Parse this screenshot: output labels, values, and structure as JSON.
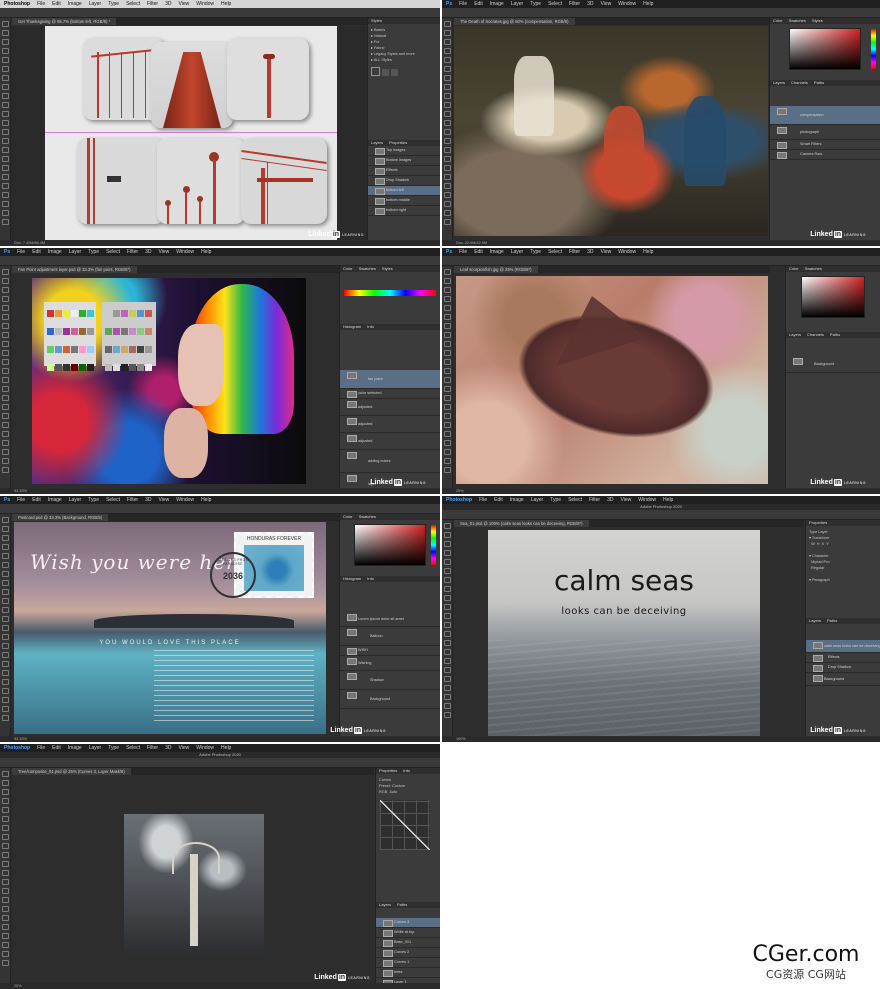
{
  "app": {
    "name": "Photoshop",
    "menu": [
      "Photoshop",
      "File",
      "Edit",
      "Image",
      "Layer",
      "Type",
      "Select",
      "Filter",
      "3D",
      "View",
      "Window",
      "Help"
    ]
  },
  "tiles": [
    {
      "tab": "Get Thanksgiving @ 95.7% (bottom left, RGB/8) *",
      "status": "Doc: 7.42M/86.4M",
      "layers": [
        "Top images",
        "Bottom images",
        "Effects",
        "Drop Shadow",
        "bottom left",
        "bottom middle",
        "bottom right"
      ]
    },
    {
      "tab": "The Death of Socrates.jpg @ 50% (compensation, RGB/8)",
      "status": "Doc: 22.9M/42.9M",
      "layers": [
        "compensation",
        "photograph",
        "Smart Filters",
        "Camera Raw"
      ]
    },
    {
      "tab": "Fan Point adjustment layer.psd @ 33.3% (fan point, RGB/8*)",
      "status": "33.33%",
      "layers": [
        "fan point",
        "color selected",
        "adjusted",
        "adjusted",
        "adjusted",
        "adding colors",
        "layer"
      ]
    },
    {
      "tab": "Leaf scorpionfish.jpg @ 25% (RGB/8*)",
      "status": "25%",
      "layers": [
        "Background"
      ]
    },
    {
      "tab": "Postcard.psd @ 33.3% (Background, RGB/8)",
      "status": "33.33%",
      "layers": [
        "Lorem ipsum dolor sit amet",
        "Balloon",
        "WISH",
        "Wishing",
        "Background",
        "Shadow"
      ]
    },
    {
      "tab": "Sea_01.psd @ 100% (calm seas looks can be deceiving, RGB/8*)",
      "window_title": "Adobe Photoshop 2020",
      "status": "100%",
      "layers": [
        "calm seas looks can be deceiving",
        "Effects",
        "Drop Shadow",
        "Background"
      ]
    },
    {
      "tab": "Tree/composite_01.psd @ 25% (Curves 3, Layer Mask/8)",
      "window_title": "Adobe Photoshop 2020",
      "status": "25%",
      "layers": [
        "Curves 3",
        "White at top",
        "Base_001",
        "Curves 2",
        "Curves 1",
        "trees",
        "Layer 1"
      ]
    }
  ],
  "postcard": {
    "title": "Wish you were here",
    "subtitle": "YOU WOULD LOVE THIS PLACE",
    "stamp": "HONDURAS FOREVER",
    "postmark_year": "2036",
    "postmark_text": "MISSIVES FROM PARADISE"
  },
  "sea": {
    "title": "calm seas",
    "subtitle": "looks can be deceiving"
  },
  "branding": {
    "linkedin": "Linked",
    "linkedin_in": "in",
    "learning": "LEARNING"
  },
  "watermark": {
    "site": "CGer.com",
    "tagline": "CG资源 CG网站"
  },
  "colors": {
    "ps_dark": "#2d2d2d",
    "ps_panel": "#3b3b3b",
    "selected_layer": "#5a6f86",
    "accent_red": "#d42323"
  }
}
